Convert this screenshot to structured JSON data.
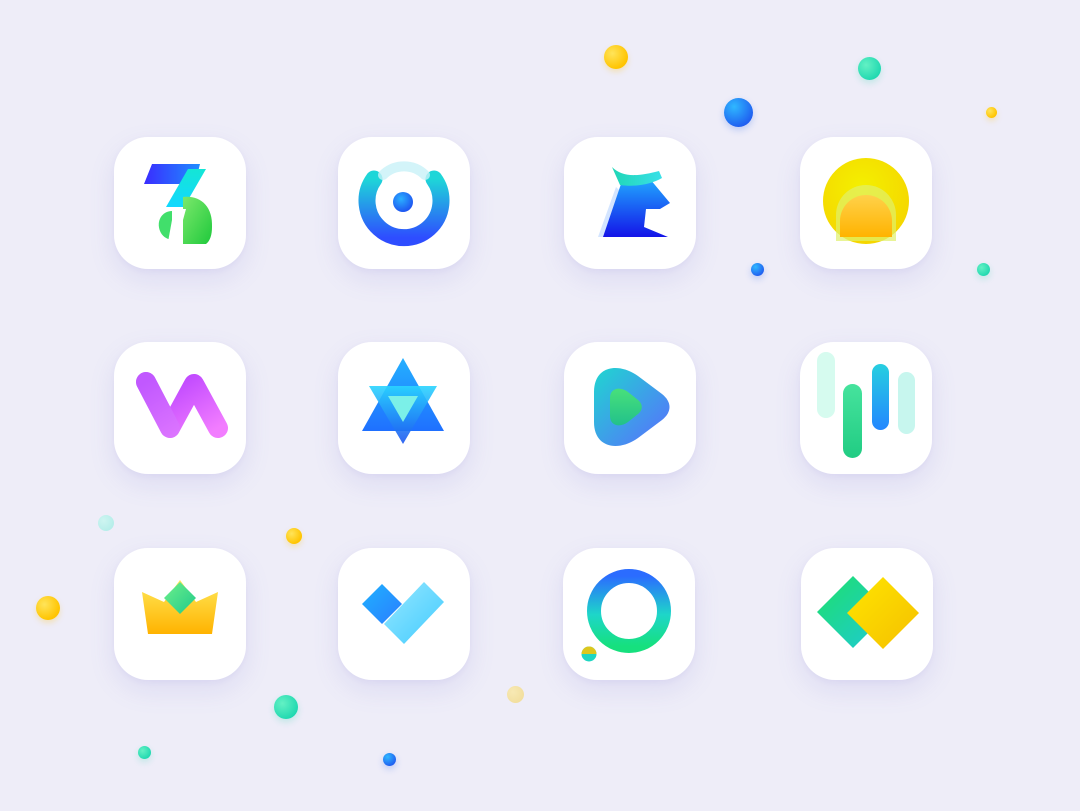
{
  "palette": {
    "background": "#eeedf8",
    "tile": "#ffffff",
    "yellow": "#ffc400",
    "blue": "#1f5ef0",
    "mint": "#1fd8b0",
    "violet": "#c14bff",
    "green": "#25d06f"
  },
  "icons": [
    {
      "name": "seven-fold-icon"
    },
    {
      "name": "ring-target-icon"
    },
    {
      "name": "unicorn-head-icon"
    },
    {
      "name": "sun-arch-icon"
    },
    {
      "name": "zigzag-m-icon"
    },
    {
      "name": "star-of-david-icon"
    },
    {
      "name": "play-leaf-icon"
    },
    {
      "name": "equalizer-bars-icon"
    },
    {
      "name": "crown-icon"
    },
    {
      "name": "diamond-heart-icon"
    },
    {
      "name": "ring-icon"
    },
    {
      "name": "twin-diamonds-icon"
    }
  ]
}
